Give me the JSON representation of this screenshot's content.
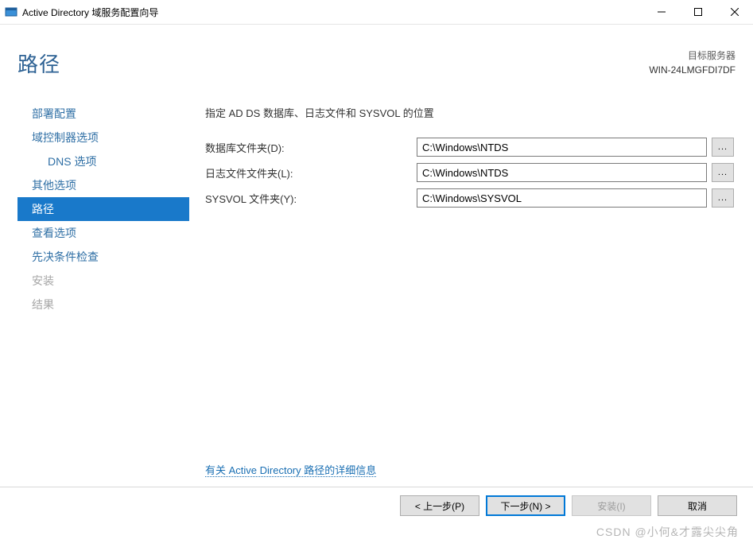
{
  "titlebar": {
    "title": "Active Directory 域服务配置向导"
  },
  "header": {
    "pageTitle": "路径",
    "targetLabel": "目标服务器",
    "targetServer": "WIN-24LMGFDI7DF"
  },
  "sidebar": {
    "items": [
      {
        "label": "部署配置",
        "state": "normal"
      },
      {
        "label": "域控制器选项",
        "state": "normal"
      },
      {
        "label": "DNS 选项",
        "state": "sub"
      },
      {
        "label": "其他选项",
        "state": "normal"
      },
      {
        "label": "路径",
        "state": "selected"
      },
      {
        "label": "查看选项",
        "state": "normal"
      },
      {
        "label": "先决条件检查",
        "state": "normal"
      },
      {
        "label": "安装",
        "state": "disabled"
      },
      {
        "label": "结果",
        "state": "disabled"
      }
    ]
  },
  "main": {
    "instruction": "指定 AD DS 数据库、日志文件和 SYSVOL 的位置",
    "rows": [
      {
        "label": "数据库文件夹(D):",
        "value": "C:\\Windows\\NTDS"
      },
      {
        "label": "日志文件文件夹(L):",
        "value": "C:\\Windows\\NTDS"
      },
      {
        "label": "SYSVOL 文件夹(Y):",
        "value": "C:\\Windows\\SYSVOL"
      }
    ],
    "browseLabel": "...",
    "moreLink": "有关 Active Directory 路径的详细信息"
  },
  "footer": {
    "prev": "< 上一步(P)",
    "next": "下一步(N) >",
    "install": "安装(I)",
    "cancel": "取消"
  },
  "watermark": "CSDN @小何&才露尖尖角"
}
